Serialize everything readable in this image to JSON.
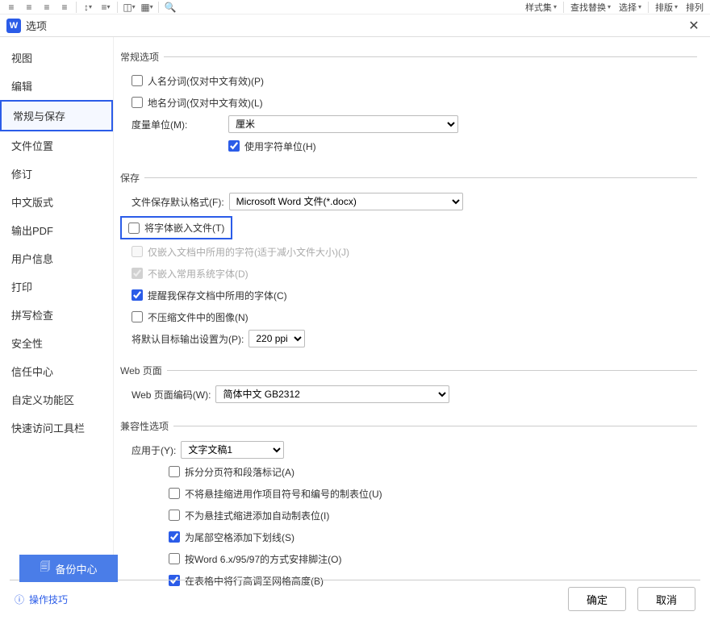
{
  "toolbar": {
    "style_set": "样式集",
    "find_replace": "查找替换",
    "select": "选择",
    "arrange1": "排版",
    "arrange2": "排列"
  },
  "titlebar": {
    "title": "选项",
    "logo": "W"
  },
  "sidebar": {
    "items": [
      {
        "label": "视图"
      },
      {
        "label": "编辑"
      },
      {
        "label": "常规与保存"
      },
      {
        "label": "文件位置"
      },
      {
        "label": "修订"
      },
      {
        "label": "中文版式"
      },
      {
        "label": "输出PDF"
      },
      {
        "label": "用户信息"
      },
      {
        "label": "打印"
      },
      {
        "label": "拼写检查"
      },
      {
        "label": "安全性"
      },
      {
        "label": "信任中心"
      },
      {
        "label": "自定义功能区"
      },
      {
        "label": "快速访问工具栏"
      }
    ],
    "selected_index": 2
  },
  "general": {
    "legend": "常规选项",
    "name_split": "人名分词(仅对中文有效)(P)",
    "place_split": "地名分词(仅对中文有效)(L)",
    "unit_label": "度量单位(M):",
    "unit_value": "厘米",
    "use_char_unit": "使用字符单位(H)"
  },
  "save": {
    "legend": "保存",
    "default_format_label": "文件保存默认格式(F):",
    "default_format_value": "Microsoft Word 文件(*.docx)",
    "embed_fonts": "将字体嵌入文件(T)",
    "embed_only_used": "仅嵌入文档中所用的字符(适于减小文件大小)(J)",
    "no_system_fonts": "不嵌入常用系统字体(D)",
    "remind_fonts": "提醒我保存文档中所用的字体(C)",
    "no_compress_img": "不压缩文件中的图像(N)",
    "default_target_label": "将默认目标输出设置为(P):",
    "default_target_value": "220 ppi"
  },
  "web": {
    "legend": "Web 页面",
    "encoding_label": "Web 页面编码(W):",
    "encoding_value": "简体中文 GB2312"
  },
  "compat": {
    "legend": "兼容性选项",
    "apply_label": "应用于(Y):",
    "apply_value": "文字文稿1",
    "opts": [
      {
        "label": "拆分分页符和段落标记(A)",
        "checked": false
      },
      {
        "label": "不将悬挂缩进用作项目符号和编号的制表位(U)",
        "checked": false
      },
      {
        "label": "不为悬挂式缩进添加自动制表位(I)",
        "checked": false
      },
      {
        "label": "为尾部空格添加下划线(S)",
        "checked": true
      },
      {
        "label": "按Word 6.x/95/97的方式安排脚注(O)",
        "checked": false
      },
      {
        "label": "在表格中将行高调至网格高度(B)",
        "checked": true
      }
    ]
  },
  "backup_center": "备份中心",
  "tips": "操作技巧",
  "btn_ok": "确定",
  "btn_cancel": "取消"
}
